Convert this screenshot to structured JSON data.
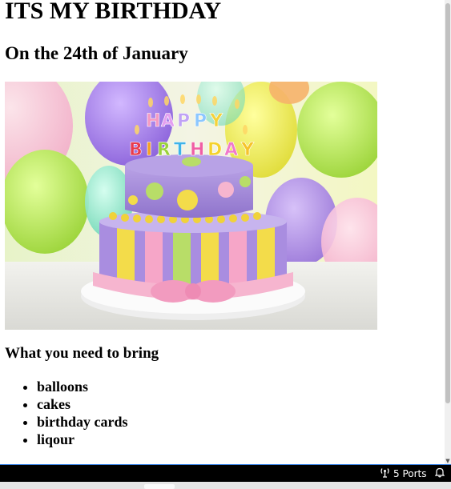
{
  "page": {
    "title": "ITS MY BIRTHDAY",
    "subtitle": "On the 24th of January",
    "image": {
      "icon": "birthday-cake-photo",
      "cake_topper_text": "HAPPY BIRTHDAY"
    },
    "list_heading": "What you need to bring",
    "items": [
      "balloons",
      "cakes",
      "birthday cards",
      "liqour"
    ]
  },
  "statusbar": {
    "ports_label": "5 Ports",
    "ports_icon": "antenna-icon",
    "bell_icon": "bell-icon",
    "background": "#000000",
    "accent": "#2c7be5"
  }
}
